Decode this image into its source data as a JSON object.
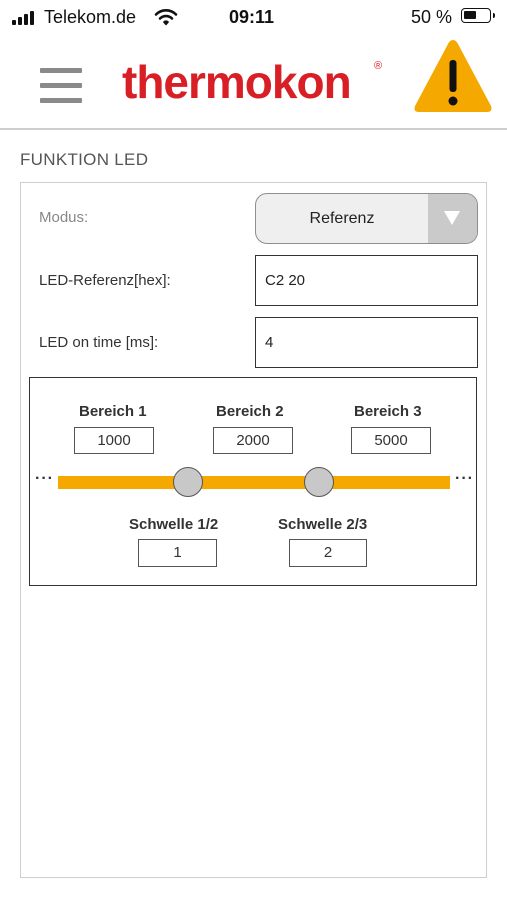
{
  "status_bar": {
    "carrier": "Telekom.de",
    "time": "09:11",
    "battery_percent": "50 %",
    "battery_level": 0.5
  },
  "header": {
    "logo_text": "thermokon",
    "logo_reg": "®",
    "accent_color": "#d81f26",
    "warning_color": "#f5a800"
  },
  "section": {
    "title": "FUNKTION LED"
  },
  "form": {
    "modus_label": "Modus:",
    "modus_value": "Referenz",
    "led_ref_label": "LED-Referenz[hex]:",
    "led_ref_value": "C2 20",
    "led_time_label": "LED on time [ms]:",
    "led_time_value": "4"
  },
  "ranges": {
    "bereich1_label": "Bereich 1",
    "bereich1_value": "1000",
    "bereich2_label": "Bereich 2",
    "bereich2_value": "2000",
    "bereich3_label": "Bereich 3",
    "bereich3_value": "5000",
    "schwelle12_label": "Schwelle 1/2",
    "schwelle12_value": "1",
    "schwelle23_label": "Schwelle 2/3",
    "schwelle23_value": "2",
    "ellipsis": "···",
    "track_color": "#f5a800"
  }
}
